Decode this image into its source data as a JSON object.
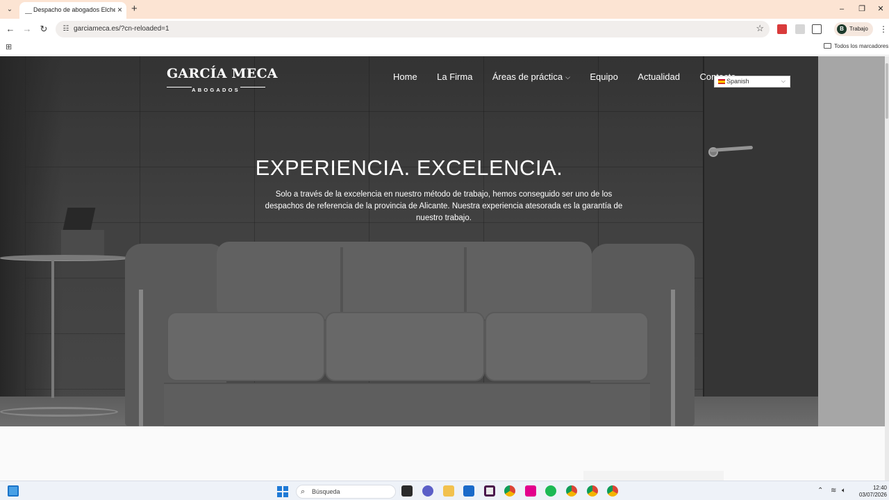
{
  "browser": {
    "tab_title": "Despacho de abogados Elche |",
    "url": "garciameca.es/?cn-reloaded=1",
    "profile_initial": "B",
    "profile_name": "Trabajo",
    "bookmarks_all": "Todos los marcadores"
  },
  "site": {
    "logo_name": "GARCÍA MECA",
    "logo_sub": "ABOGADOS",
    "nav": [
      {
        "label": "Home"
      },
      {
        "label": "La Firma"
      },
      {
        "label": "Áreas de práctica"
      },
      {
        "label": "Equipo"
      },
      {
        "label": "Actualidad"
      },
      {
        "label": "Contacto"
      }
    ],
    "language": "Spanish",
    "headline": "EXPERIENCIA. EXCELENCIA.",
    "subtext": "Solo a través de la excelencia en nuestro método de trabajo, hemos conseguido ser uno de los despachos de referencia de la provincia de Alicante. Nuestra experiencia atesorada es la garantía de nuestro trabajo."
  },
  "taskbar": {
    "search_placeholder": "Búsqueda",
    "time": "12:40",
    "date": "03/07/2026"
  },
  "colors": {
    "tabstrip": "#fce4d3",
    "hero_dark": "#3b3b3b",
    "text_on_hero": "#ffffff"
  }
}
